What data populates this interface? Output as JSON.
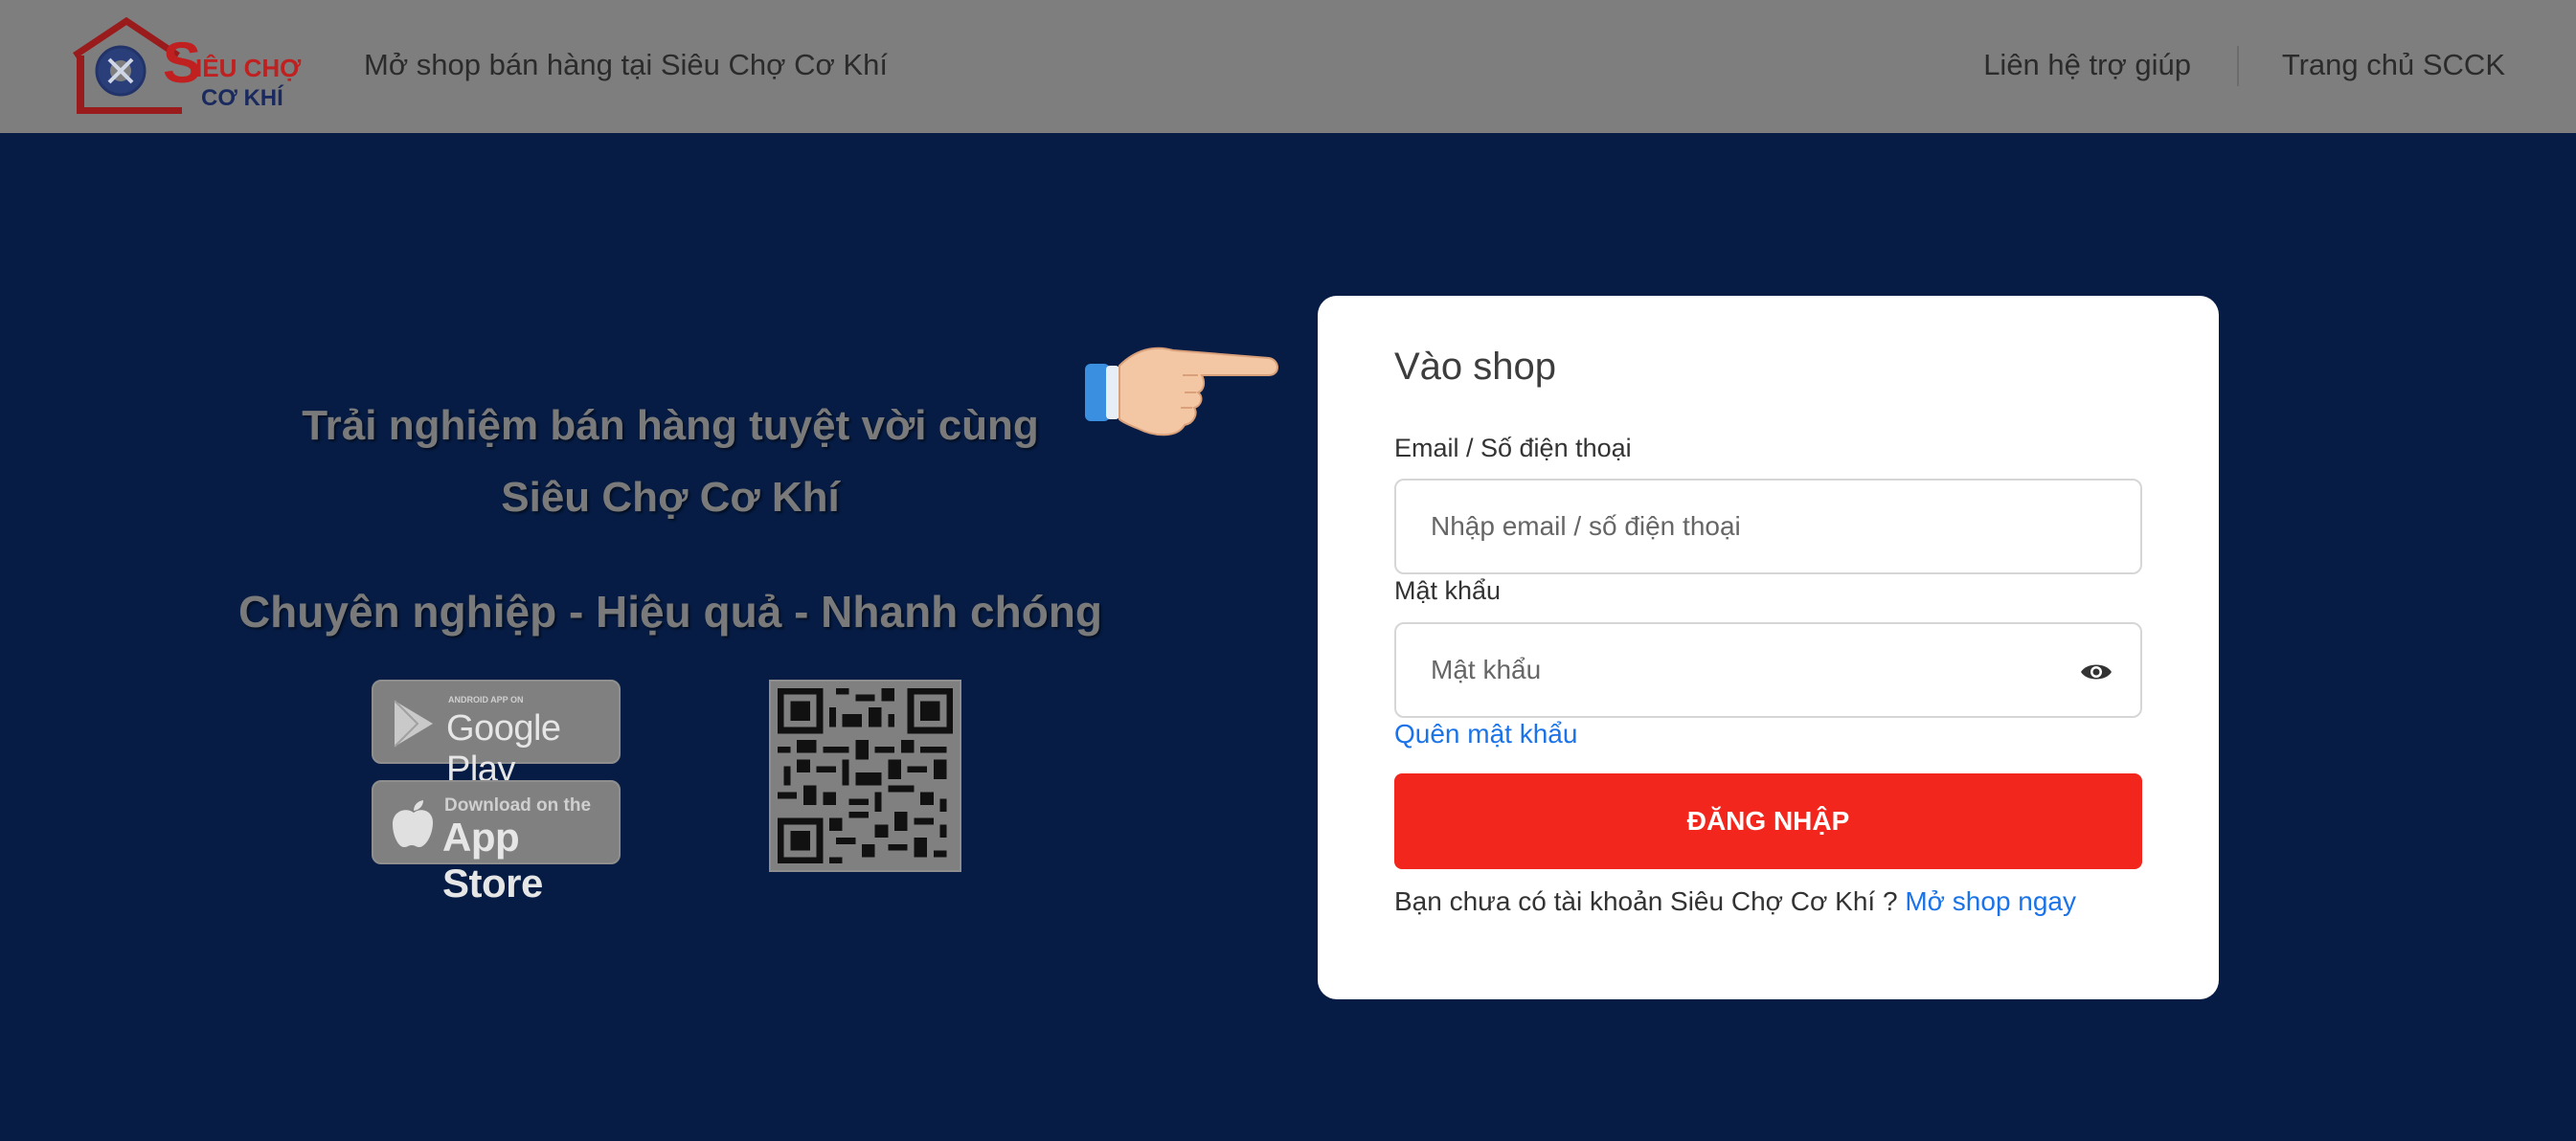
{
  "header": {
    "logo_text_line1": "SIÊU CHỢ",
    "logo_text_line2": "CƠ KHÍ",
    "tagline": "Mở shop bán hàng tại Siêu Chợ Cơ Khí",
    "nav_help": "Liên hệ trợ giúp",
    "nav_home": "Trang chủ SCCK"
  },
  "promo": {
    "line1": "Trải nghiệm bán hàng tuyệt vời cùng",
    "line2": "Siêu Chợ Cơ Khí",
    "line3": "Chuyên nghiệp - Hiệu quả - Nhanh chóng",
    "google_small": "ANDROID APP ON",
    "google_big": "Google Play",
    "apple_small": "Download on the",
    "apple_big": "App Store"
  },
  "login": {
    "title": "Vào shop",
    "email_label": "Email / Số điện thoại",
    "email_placeholder": "Nhập email / số điện thoại",
    "password_label": "Mật khẩu",
    "password_placeholder": "Mật khẩu",
    "forgot": "Quên mật khẩu",
    "submit": "ĐĂNG NHẬP",
    "signup_prompt": "Bạn chưa có tài khoản Siêu Chợ Cơ Khí ?",
    "signup_link": "Mở shop ngay"
  },
  "colors": {
    "background": "#061c44",
    "header": "#7e7e7e",
    "primary_button": "#f2261c",
    "link": "#1a73e8"
  },
  "icons": {
    "logo": "house-gear-logo",
    "hand": "pointing-hand-icon",
    "eye": "eye-icon",
    "google_play": "play-icon",
    "apple": "apple-icon"
  }
}
